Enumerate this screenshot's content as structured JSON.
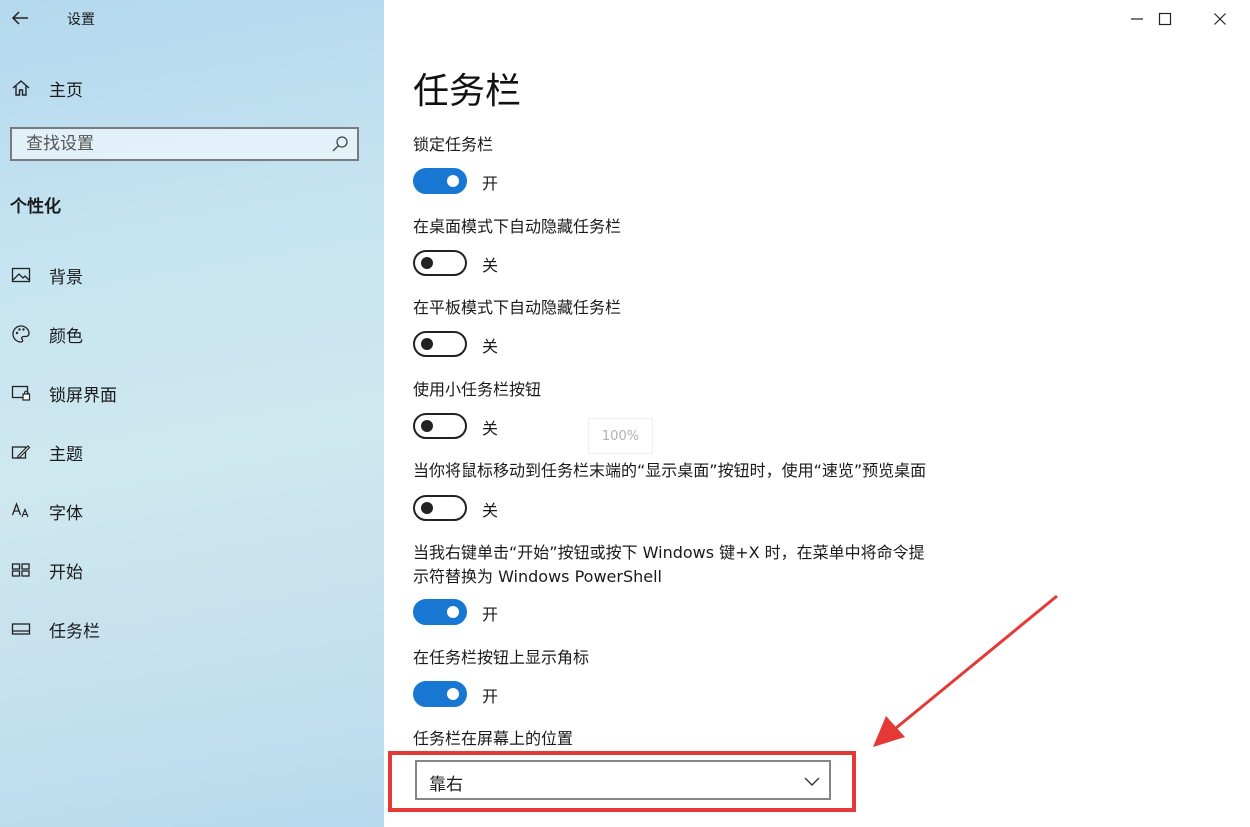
{
  "app": {
    "title": "设置"
  },
  "sidebar": {
    "home_label": "主页",
    "search_placeholder": "查找设置",
    "section_title": "个性化",
    "items": [
      {
        "label": "背景",
        "icon": "picture-icon"
      },
      {
        "label": "颜色",
        "icon": "palette-icon"
      },
      {
        "label": "锁屏界面",
        "icon": "lock-screen-icon"
      },
      {
        "label": "主题",
        "icon": "theme-icon"
      },
      {
        "label": "字体",
        "icon": "font-icon"
      },
      {
        "label": "开始",
        "icon": "start-icon"
      },
      {
        "label": "任务栏",
        "icon": "taskbar-icon"
      }
    ]
  },
  "main": {
    "title": "任务栏",
    "settings": [
      {
        "label": "锁定任务栏",
        "state": "开",
        "on": true
      },
      {
        "label": "在桌面模式下自动隐藏任务栏",
        "state": "关",
        "on": false
      },
      {
        "label": "在平板模式下自动隐藏任务栏",
        "state": "关",
        "on": false
      },
      {
        "label": "使用小任务栏按钮",
        "state": "关",
        "on": false
      },
      {
        "label": "当你将鼠标移动到任务栏末端的“显示桌面”按钮时，使用“速览”预览桌面",
        "state": "关",
        "on": false
      },
      {
        "label_line1": "当我右键单击“开始”按钮或按下 Windows 键+X 时，在菜单中将命令提",
        "label_line2": "示符替换为 Windows PowerShell",
        "state": "开",
        "on": true
      },
      {
        "label": "在任务栏按钮上显示角标",
        "state": "开",
        "on": true
      }
    ],
    "position": {
      "label": "任务栏在屏幕上的位置",
      "value": "靠右"
    },
    "zoom": "100%"
  },
  "colors": {
    "accent": "#1877d2",
    "annotation": "#e53935"
  }
}
